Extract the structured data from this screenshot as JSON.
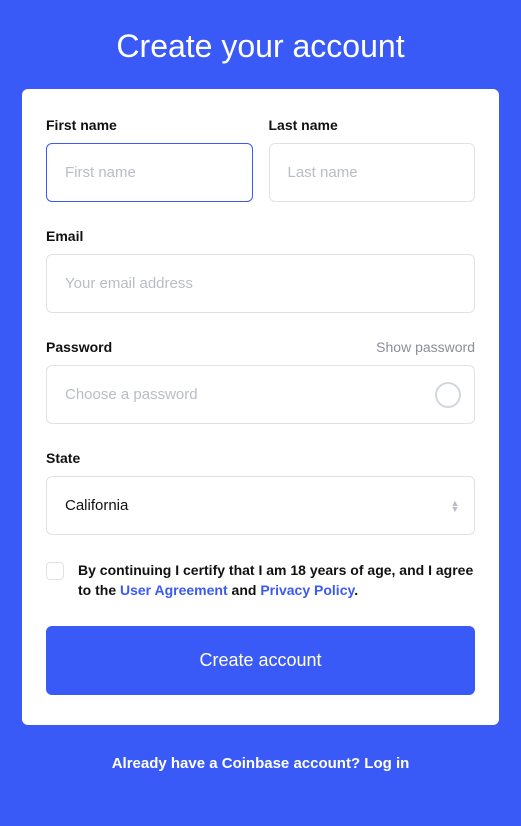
{
  "title": "Create your account",
  "fields": {
    "first_name": {
      "label": "First name",
      "placeholder": "First name",
      "value": ""
    },
    "last_name": {
      "label": "Last name",
      "placeholder": "Last name",
      "value": ""
    },
    "email": {
      "label": "Email",
      "placeholder": "Your email address",
      "value": ""
    },
    "password": {
      "label": "Password",
      "placeholder": "Choose a password",
      "value": "",
      "show_label": "Show password"
    },
    "state": {
      "label": "State",
      "value": "California"
    }
  },
  "certify": {
    "text_before": "By continuing I certify that I am 18 years of age, and I agree to the ",
    "link1": "User Agreement",
    "text_mid": " and ",
    "link2": "Privacy Policy",
    "text_after": "."
  },
  "submit_label": "Create account",
  "footer": {
    "text": "Already have a Coinbase account? ",
    "link": "Log in"
  }
}
